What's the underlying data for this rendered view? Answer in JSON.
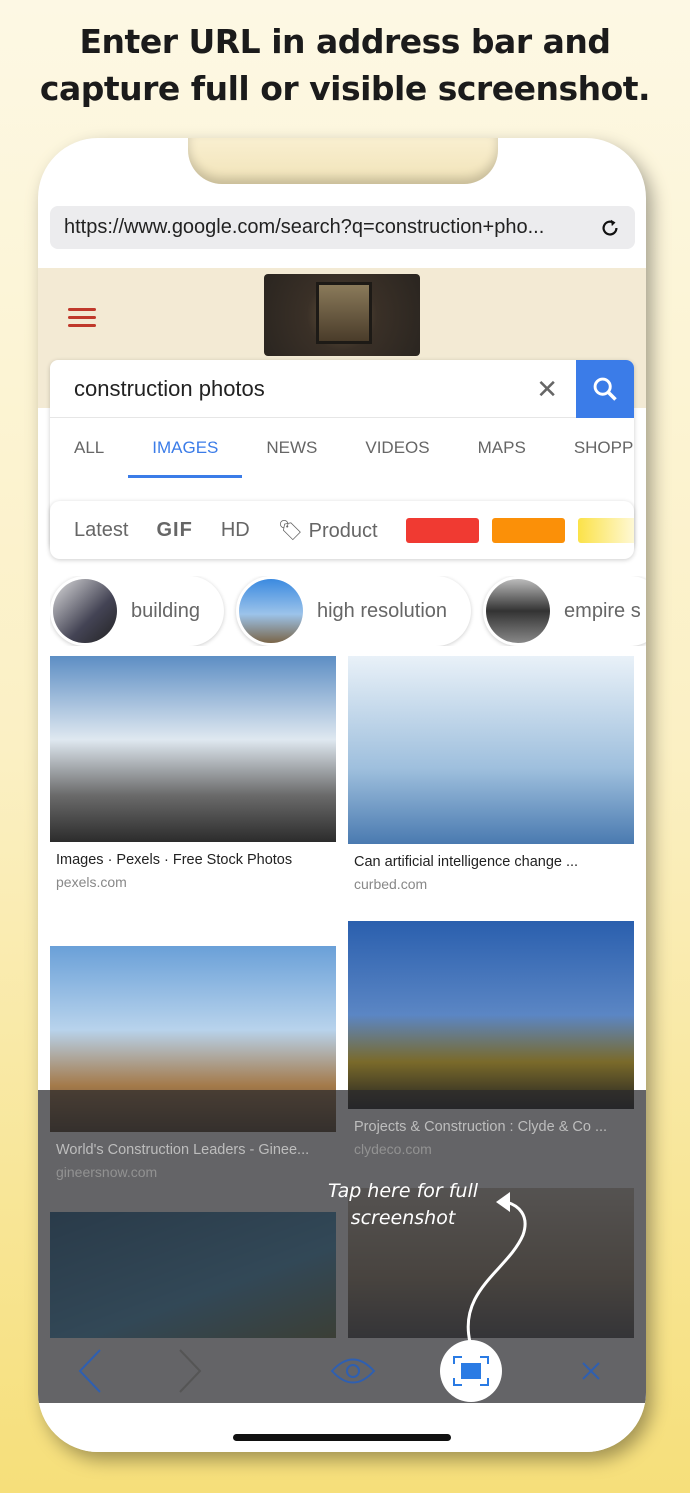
{
  "headline": [
    "Enter URL in address bar and",
    "capture full or visible screenshot."
  ],
  "browser": {
    "url": "https://www.google.com/search?q=construction+pho...",
    "reload_icon": "reload-icon"
  },
  "search": {
    "query": "construction photos",
    "clear_icon": "close-icon",
    "search_icon": "search-icon",
    "tabs": [
      {
        "label": "ALL"
      },
      {
        "label": "IMAGES",
        "active": true
      },
      {
        "label": "NEWS"
      },
      {
        "label": "VIDEOS"
      },
      {
        "label": "MAPS"
      },
      {
        "label": "SHOPP"
      }
    ]
  },
  "filters": {
    "items": [
      "Latest",
      "GIF",
      "HD",
      "Product"
    ],
    "colors": [
      "#f03a32",
      "#fb9008",
      "#fbe248"
    ]
  },
  "chips": [
    "building",
    "high resolution",
    "empire s"
  ],
  "results": [
    {
      "title": "Images · Pexels · Free Stock Photos",
      "source": "pexels.com"
    },
    {
      "title": "Can artificial intelligence change ...",
      "source": "curbed.com"
    },
    {
      "title": "World's Construction Leaders - Ginee...",
      "source": "gineersnow.com"
    },
    {
      "title": "Projects & Construction : Clyde & Co ...",
      "source": "clydeco.com"
    }
  ],
  "hint": "Tap here for full screenshot",
  "accent": "#3b7ce8"
}
